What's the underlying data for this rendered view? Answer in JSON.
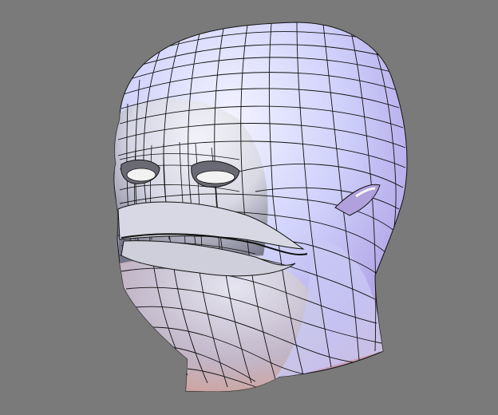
{
  "viewport": {
    "background_color": "#7a7a7a",
    "object": {
      "kind": "3d-head-mesh",
      "shading": "smooth",
      "wireframe_overlay": true,
      "base_color": "#c6c8f2",
      "rim_color": "#d59a8f",
      "shadow_color": "#3b3b46",
      "wire_color": "#111111",
      "eye_color": "#f2f2f2"
    }
  }
}
